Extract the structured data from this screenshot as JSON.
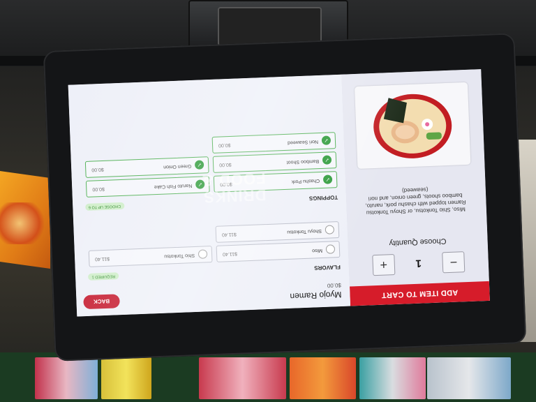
{
  "kiosk": {
    "item_name": "Myojo Ramen",
    "item_price": "$0.00",
    "back_label": "BACK",
    "add_to_cart_label": "ADD ITEM TO CART",
    "quantity_label": "Choose Quantity",
    "quantity_value": "1",
    "minus_symbol": "−",
    "plus_symbol": "+",
    "description": "Miso, Shio Tonkotsu, or Shoyu Tonkotsu Ramen topped with chashu pork, naruto, bamboo shoots, green onion, and nori (seaweed)",
    "food_image_icon": "ramen-bowl-image",
    "flavors": {
      "title": "FLAVORS",
      "badge": "REQUIRED 1",
      "options": [
        {
          "name": "Miso",
          "price": "$11.40",
          "checked": false
        },
        {
          "name": "Shio Tonkotsu",
          "price": "$11.40",
          "checked": false
        },
        {
          "name": "Shoyu Tonkotsu",
          "price": "$11.40",
          "checked": false
        }
      ]
    },
    "toppings": {
      "title": "TOPPINGS",
      "badge": "CHOOSE UP TO 6",
      "options": [
        {
          "name": "Chashu Pork",
          "price": "$0.00",
          "checked": true
        },
        {
          "name": "Naruto Fish Cake",
          "price": "$0.00",
          "checked": true
        },
        {
          "name": "Bamboo Shoot",
          "price": "$0.00",
          "checked": true
        },
        {
          "name": "Green Onion",
          "price": "$0.00",
          "checked": true
        },
        {
          "name": "Nori Seaweed",
          "price": "$0.00",
          "checked": true
        }
      ]
    },
    "check_glyph": "✓",
    "reflection_text": "DRINKS\nFOOD &",
    "colors": {
      "accent_red": "#d61c2a",
      "check_green": "#2e9b3a",
      "badge_green_bg": "#cfeec9"
    }
  }
}
